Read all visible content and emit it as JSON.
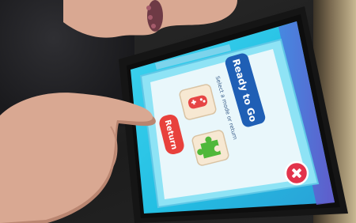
{
  "dialog": {
    "title_button_label": "Ready to Go",
    "subtitle": "Select a mode or return",
    "return_button_label": "Return",
    "close_icon": "close-x-icon",
    "mode_icons": [
      "gamepad-icon",
      "puzzle-piece-icon"
    ]
  },
  "colors": {
    "screen_background": "#27c6e6",
    "dialog_frame": "#8ee3f5",
    "dialog_panel": "#e9f7fb",
    "ready_button": "#1f5fb5",
    "return_button": "#e8413c",
    "close_button": "#e2334b",
    "gamepad": "#e64545",
    "puzzle": "#4fb83a"
  }
}
